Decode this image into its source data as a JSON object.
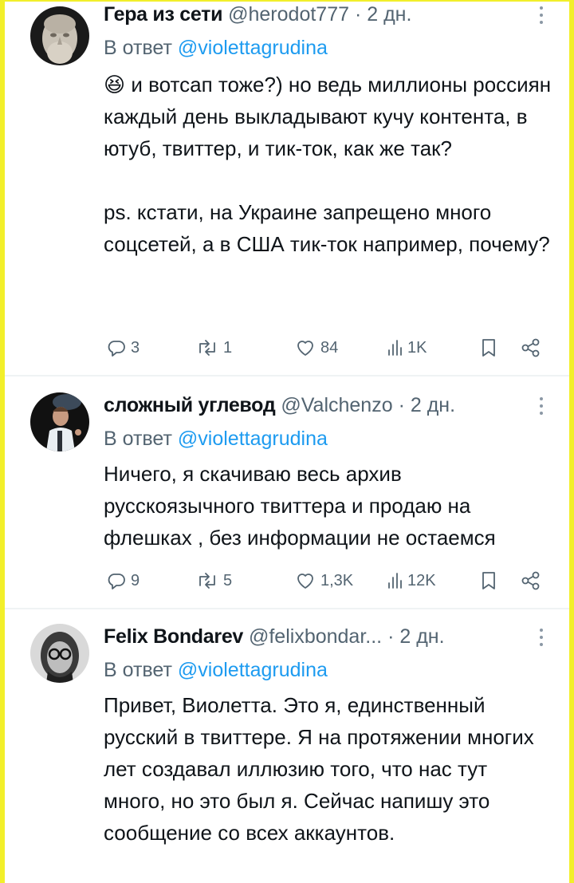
{
  "tweets": [
    {
      "name": "Гера из сети",
      "handle": "@herodot777",
      "dot": "·",
      "time": "2 дн.",
      "reply_prefix": "В ответ",
      "reply_to": "@violettagrudina",
      "emoji": "😆",
      "text": "и вотсап тоже?) но ведь миллионы россиян каждый день выкладывают кучу контента, в ютуб, твиттер, и тик-ток, как же так?\n\nps. кстати, на Украине запрещено много соцсетей, а в США тик-ток например, почему?",
      "replies": "3",
      "reposts": "1",
      "likes": "84",
      "views": "1K"
    },
    {
      "name": "сложный углевод",
      "handle": "@Valchenzo",
      "dot": "·",
      "time": "2 дн.",
      "reply_prefix": "В ответ",
      "reply_to": "@violettagrudina",
      "text": "Ничего, я скачиваю весь архив русскоязычного твиттера и продаю на флешках , без информации не остаемся",
      "replies": "9",
      "reposts": "5",
      "likes": "1,3K",
      "views": "12K"
    },
    {
      "name": "Felix Bondarev",
      "handle": "@felixbondar...",
      "dot": "·",
      "time": "2 дн.",
      "reply_prefix": "В ответ",
      "reply_to": "@violettagrudina",
      "text": "Привет, Виолетта. Это я, единственный русский в твиттере. Я на протяжении многих лет создавал иллюзию того, что нас тут много, но это был я. Сейчас напишу это сообщение со всех аккаунтов."
    }
  ],
  "icons": [
    "reply-icon",
    "repost-icon",
    "like-icon",
    "views-icon",
    "bookmark-icon",
    "share-icon",
    "more-icon"
  ],
  "colors": {
    "text": "#0f1419",
    "secondary": "#536471",
    "link": "#1d9bf0",
    "frame": "#f2ef2a"
  }
}
